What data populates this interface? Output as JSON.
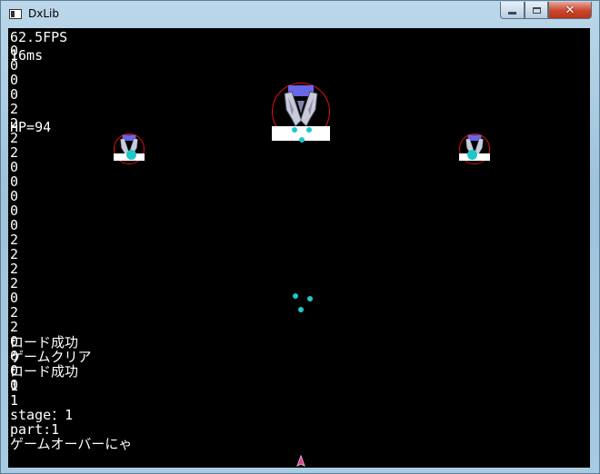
{
  "window": {
    "title": "DxLib",
    "controls": {
      "minimize": "minimize",
      "maximize": "maximize",
      "close": "close"
    }
  },
  "hud": {
    "fps": "62.5FPS",
    "ms": "16ms",
    "hp": "HP=94",
    "number_column": [
      "0",
      "0",
      "0",
      "0",
      "2",
      "2",
      "2",
      "2",
      "0",
      "0",
      "0",
      "0",
      "0",
      "2",
      "2",
      "2",
      "2",
      "0",
      "2",
      "2",
      "0",
      "0",
      "0",
      "0"
    ],
    "log": [
      "ロード成功",
      "ゲームクリア",
      "ロード成功",
      "1",
      "1",
      "stage：1",
      "part:1",
      "ゲームオーバーにゃ"
    ]
  },
  "scene": {
    "enemies": [
      {
        "name": "boss-enemy",
        "icon": "mecha-ship-icon"
      },
      {
        "name": "left-enemy",
        "icon": "mecha-ship-icon"
      },
      {
        "name": "right-enemy",
        "icon": "mecha-ship-icon"
      }
    ],
    "colors": {
      "background": "#000000",
      "bullet": "#1ec8c8",
      "enemy_circle": "#e01010",
      "player": "#d04090"
    }
  }
}
